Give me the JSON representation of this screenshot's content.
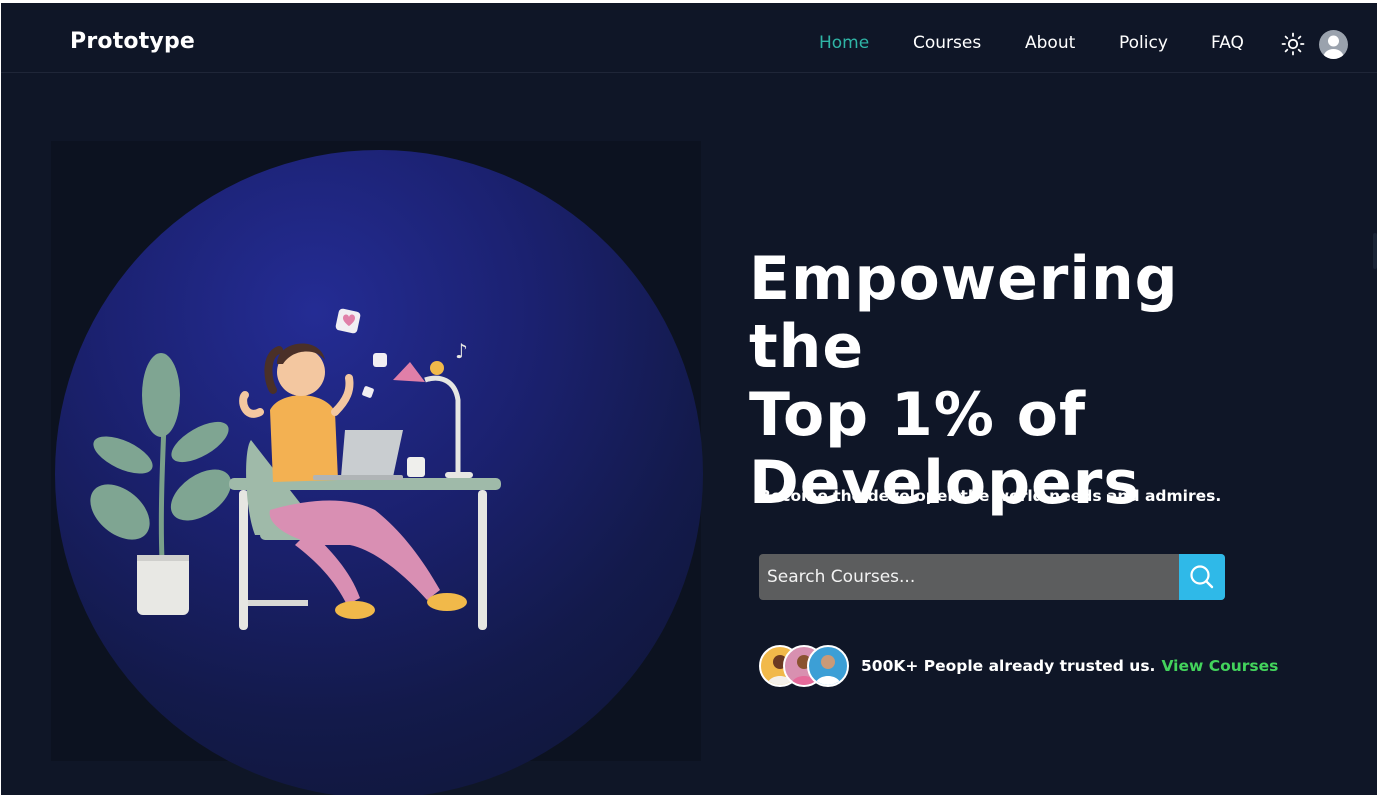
{
  "brand": {
    "name": "Prototype"
  },
  "nav": {
    "items": [
      {
        "label": "Home",
        "active": true
      },
      {
        "label": "Courses",
        "active": false
      },
      {
        "label": "About",
        "active": false
      },
      {
        "label": "Policy",
        "active": false
      },
      {
        "label": "FAQ",
        "active": false
      }
    ],
    "theme_icon": "sun-icon",
    "avatar_icon": "user-avatar-icon"
  },
  "hero": {
    "headline_lines": [
      "Empowering the",
      "Top 1% of",
      "Developers"
    ],
    "subheadline": "Become the developer the world needs and admires.",
    "search": {
      "placeholder": "Search Courses...",
      "button_icon": "search-icon"
    },
    "trust": {
      "text": "500K+ People already trusted us.",
      "link": "View Courses"
    }
  },
  "colors": {
    "background": "#0f1627",
    "accent_active_nav": "#2fb5a6",
    "search_button": "#2fb9e8",
    "link_green": "#43d35c",
    "hero_circle": "#1b2170"
  }
}
